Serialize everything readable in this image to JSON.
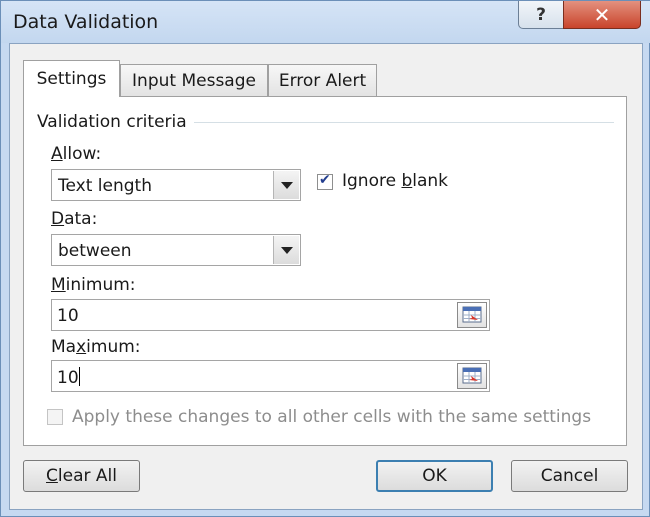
{
  "window": {
    "title": "Data Validation",
    "help_label": "?",
    "close_label": "✕"
  },
  "tabs": [
    {
      "label": "Settings",
      "active": true
    },
    {
      "label": "Input Message",
      "active": false
    },
    {
      "label": "Error Alert",
      "active": false
    }
  ],
  "settings": {
    "group_label": "Validation criteria",
    "allow": {
      "label_underlined": "A",
      "label_rest": "llow:",
      "selected": "Text length"
    },
    "ignore_blank": {
      "label_prefix": "Ignore ",
      "label_underlined": "b",
      "label_rest": "lank",
      "checked": true
    },
    "data": {
      "label_underlined": "D",
      "label_rest": "ata:",
      "selected": "between"
    },
    "minimum": {
      "label_underlined": "M",
      "label_rest": "inimum:",
      "value": "10"
    },
    "maximum": {
      "label_prefix": "Ma",
      "label_underlined": "x",
      "label_rest": "imum:",
      "value": "10"
    },
    "apply_all": {
      "label": "Apply these changes to all other cells with the same settings",
      "checked": false,
      "enabled": false
    }
  },
  "footer": {
    "clear_all": {
      "label_underlined": "C",
      "label_rest": "lear All"
    },
    "ok_label": "OK",
    "cancel_label": "Cancel"
  },
  "icons": {
    "refedit": "collapse-dialog-icon",
    "dropdown": "chevron-down-icon"
  },
  "colors": {
    "frame": "#c6d9f1",
    "close_button": "#c9442b",
    "default_button_border": "#3c7fb1"
  }
}
